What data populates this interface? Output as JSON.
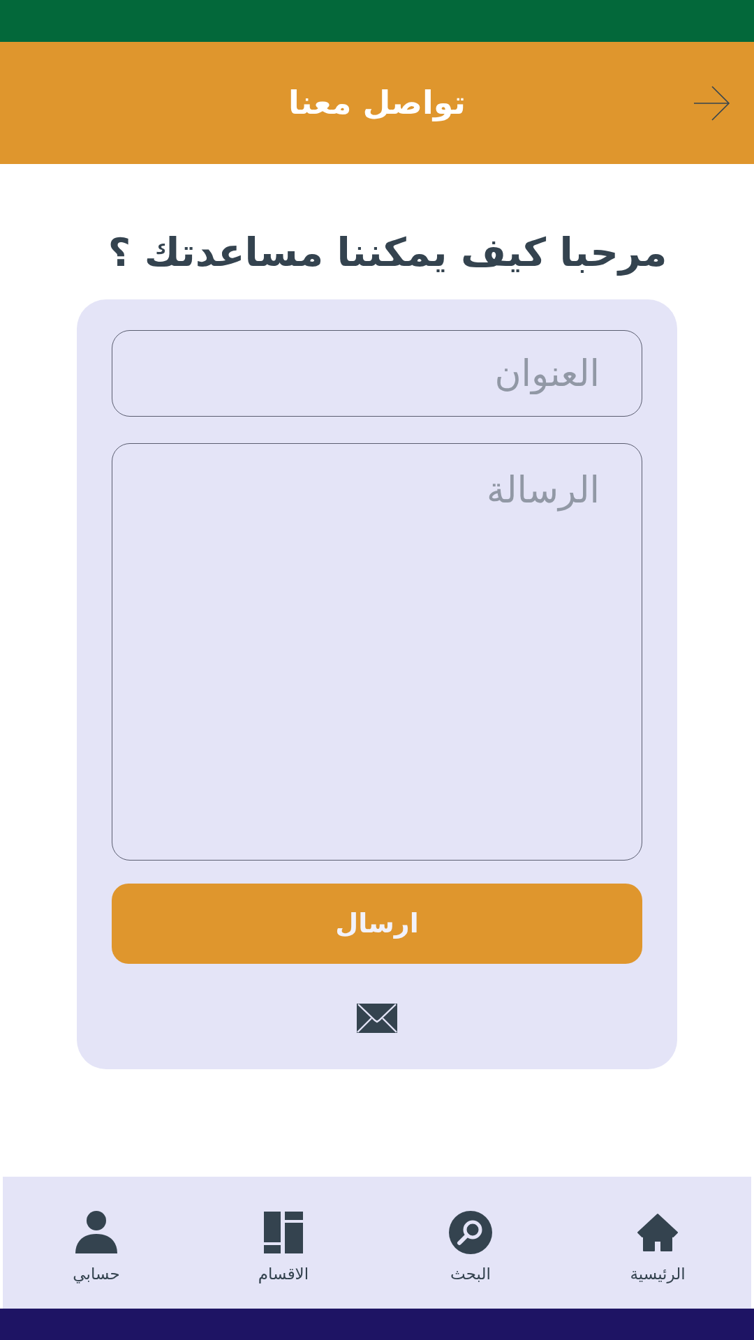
{
  "header": {
    "title": "تواصل معنا"
  },
  "heading": "مرحبا كيف يمكننا مساعدتك ؟",
  "form": {
    "subject": {
      "placeholder": "العنوان"
    },
    "message": {
      "placeholder": "الرسالة"
    },
    "submit": "ارسال"
  },
  "bottom_nav": [
    {
      "label": "الرئيسية",
      "kind": "home"
    },
    {
      "label": "البحث",
      "kind": "search"
    },
    {
      "label": "الاقسام",
      "kind": "categories"
    },
    {
      "label": "حسابي",
      "kind": "account"
    }
  ]
}
